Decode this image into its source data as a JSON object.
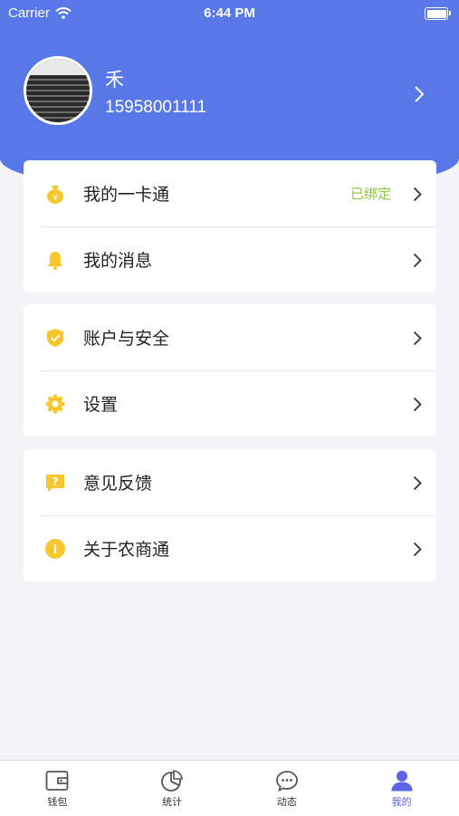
{
  "status_bar": {
    "carrier": "Carrier",
    "time": "6:44 PM"
  },
  "profile": {
    "name": "禾",
    "phone": "15958001111"
  },
  "groups": [
    {
      "items": [
        {
          "label": "我的一卡通",
          "status": "已绑定",
          "icon": "wallet-bag-icon"
        },
        {
          "label": "我的消息",
          "status": "",
          "icon": "bell-icon"
        }
      ]
    },
    {
      "items": [
        {
          "label": "账户与安全",
          "status": "",
          "icon": "shield-check-icon"
        },
        {
          "label": "设置",
          "status": "",
          "icon": "gear-icon"
        }
      ]
    },
    {
      "items": [
        {
          "label": "意见反馈",
          "status": "",
          "icon": "feedback-question-icon"
        },
        {
          "label": "关于农商通",
          "status": "",
          "icon": "info-icon"
        }
      ]
    }
  ],
  "tabs": [
    {
      "label": "钱包",
      "icon": "wallet-icon"
    },
    {
      "label": "统计",
      "icon": "pie-chart-icon"
    },
    {
      "label": "动态",
      "icon": "chat-bubble-icon"
    },
    {
      "label": "我的",
      "icon": "user-icon",
      "active": true
    }
  ],
  "colors": {
    "primary": "#5878e8",
    "icon_yellow": "#f8c72e",
    "bound_green": "#8cc63f",
    "active_tab": "#5b63e8"
  }
}
